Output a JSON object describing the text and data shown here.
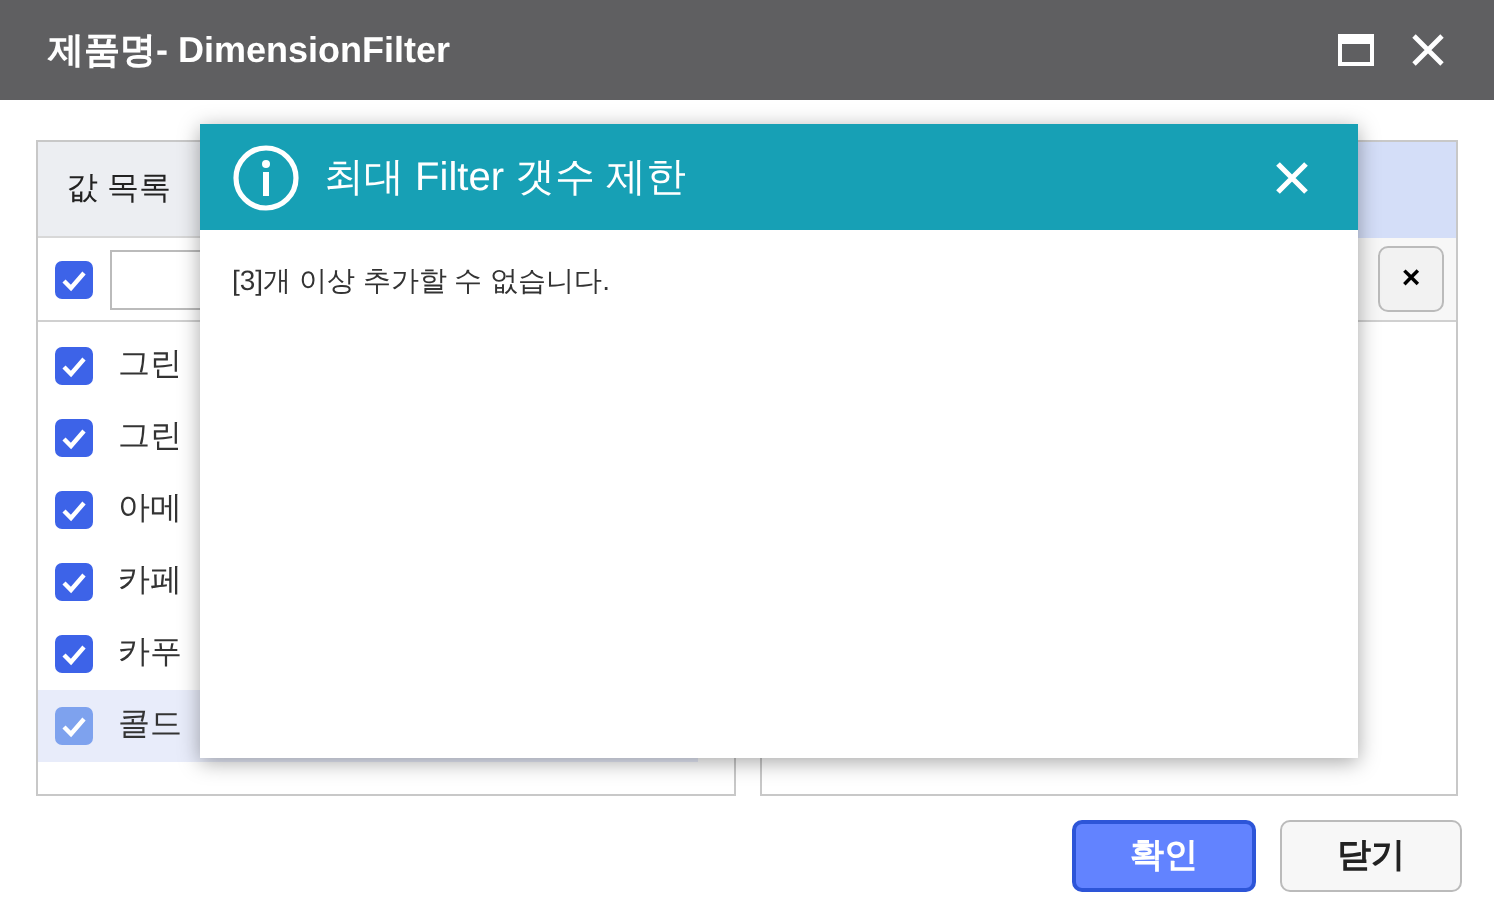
{
  "window": {
    "title": "제품명- DimensionFilter"
  },
  "left_panel": {
    "header": "값 목록",
    "select_all": {
      "checked": true
    },
    "items": [
      {
        "label": "그린",
        "checked": true,
        "selected": false
      },
      {
        "label": "그린",
        "checked": true,
        "selected": false
      },
      {
        "label": "아메",
        "checked": true,
        "selected": false
      },
      {
        "label": "카페",
        "checked": true,
        "selected": false
      },
      {
        "label": "카푸",
        "checked": true,
        "selected": false
      },
      {
        "label": "콜드",
        "checked": true,
        "selected": true
      }
    ]
  },
  "right_panel": {
    "clear_button": "×"
  },
  "dialog": {
    "title": "최대 Filter 갯수 제한",
    "message": "[3]개 이상 추가할 수 없습니다."
  },
  "buttons": [
    {
      "label": "확인",
      "kind": "primary"
    },
    {
      "label": "닫기",
      "kind": "secondary"
    }
  ]
}
